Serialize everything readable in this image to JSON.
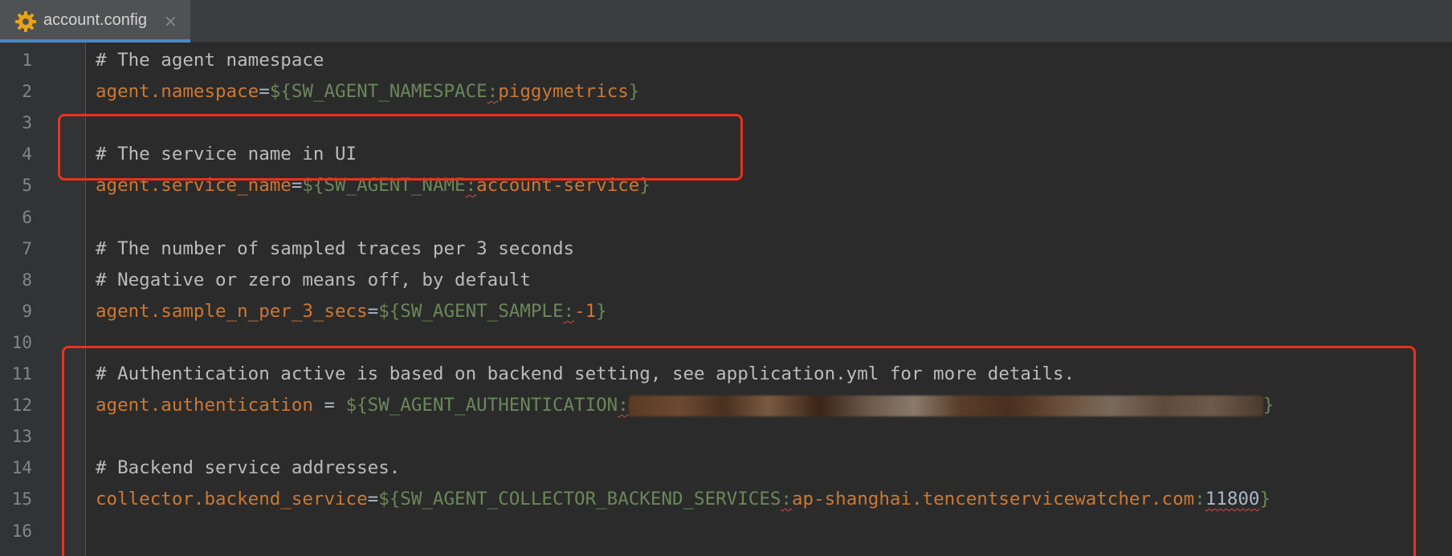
{
  "tab": {
    "label": "account.config",
    "icon": "gear-config-icon",
    "close": "×"
  },
  "colors": {
    "comment": "#bbbbbb",
    "key": "#cc7832",
    "env_var": "#6a8759",
    "highlight_box": "#e8321e"
  },
  "lines": [
    {
      "num": "1",
      "comment": "# The agent namespace"
    },
    {
      "num": "2",
      "key": "agent.namespace",
      "eq": "=",
      "open": "${",
      "env": "SW_AGENT_NAMESPACE",
      "colon": ":",
      "default": "piggymetrics",
      "close": "}"
    },
    {
      "num": "3"
    },
    {
      "num": "4",
      "comment": "# The service name in UI"
    },
    {
      "num": "5",
      "key": "agent.service_name",
      "eq": "=",
      "open": "${",
      "env": "SW_AGENT_NAME",
      "colon": ":",
      "default": "account-service",
      "close": "}"
    },
    {
      "num": "6"
    },
    {
      "num": "7",
      "comment": "# The number of sampled traces per 3 seconds"
    },
    {
      "num": "8",
      "comment": "# Negative or zero means off, by default"
    },
    {
      "num": "9",
      "key": "agent.sample_n_per_3_secs",
      "eq": "=",
      "open": "${",
      "env": "SW_AGENT_SAMPLE",
      "colon": ":",
      "default": "-1",
      "close": "}"
    },
    {
      "num": "10"
    },
    {
      "num": "11",
      "comment": "# Authentication active is based on backend setting, see application.yml for more details."
    },
    {
      "num": "12",
      "key": "agent.authentication",
      "eq": " = ",
      "open": "${",
      "env": "SW_AGENT_AUTHENTICATION",
      "colon": ":",
      "close": "}"
    },
    {
      "num": "13"
    },
    {
      "num": "14",
      "comment": "# Backend service addresses."
    },
    {
      "num": "15",
      "key": "collector.backend_service",
      "eq": "=",
      "open": "${",
      "env": "SW_AGENT_COLLECTOR_BACKEND_SERVICES",
      "colon": ":",
      "default": "ap-shanghai.tencentservicewatcher.com",
      "colon2": ":",
      "port": "11800",
      "close": "}"
    },
    {
      "num": "16"
    }
  ]
}
